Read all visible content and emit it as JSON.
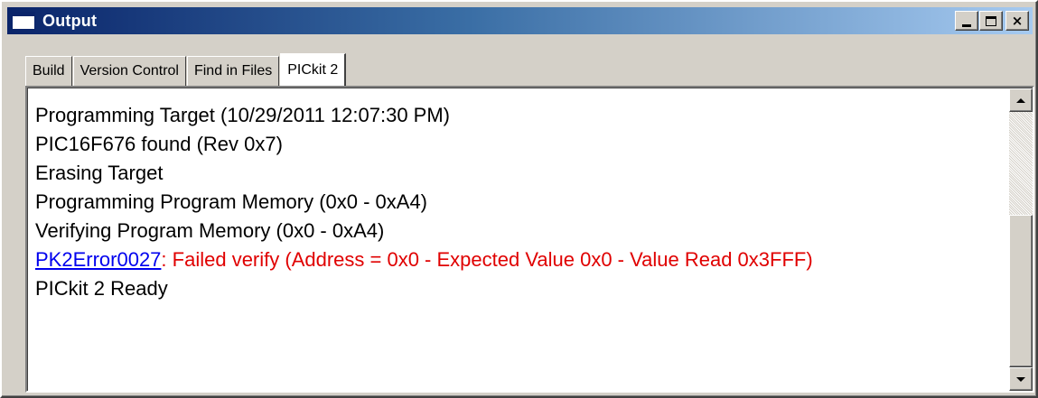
{
  "window": {
    "title": "Output",
    "minimize_glyph": "_",
    "maximize_glyph": "□",
    "close_glyph": "×"
  },
  "tabs": [
    {
      "label": "Build",
      "active": false
    },
    {
      "label": "Version Control",
      "active": false
    },
    {
      "label": "Find in Files",
      "active": false
    },
    {
      "label": "PICkit 2",
      "active": true
    }
  ],
  "output": {
    "lines": [
      "Programming Target (10/29/2011  12:07:30 PM)",
      "PIC16F676 found (Rev 0x7)",
      "Erasing Target",
      "Programming Program Memory (0x0 - 0xA4)",
      "Verifying Program Memory (0x0 - 0xA4)"
    ],
    "error": {
      "code": "PK2Error0027",
      "separator": ":",
      "message": " Failed verify (Address = 0x0 - Expected Value 0x0 - Value Read 0x3FFF)"
    },
    "final_line": "PICkit 2 Ready"
  },
  "colors": {
    "titlebar_start": "#0a246a",
    "titlebar_end": "#a6caf0",
    "error_link": "#0000ee",
    "error_message": "#e00000",
    "window_face": "#d4d0c8"
  },
  "icons": {
    "title_icon": "window-icon",
    "scroll_up": "arrow-up-icon",
    "scroll_down": "arrow-down-icon"
  }
}
